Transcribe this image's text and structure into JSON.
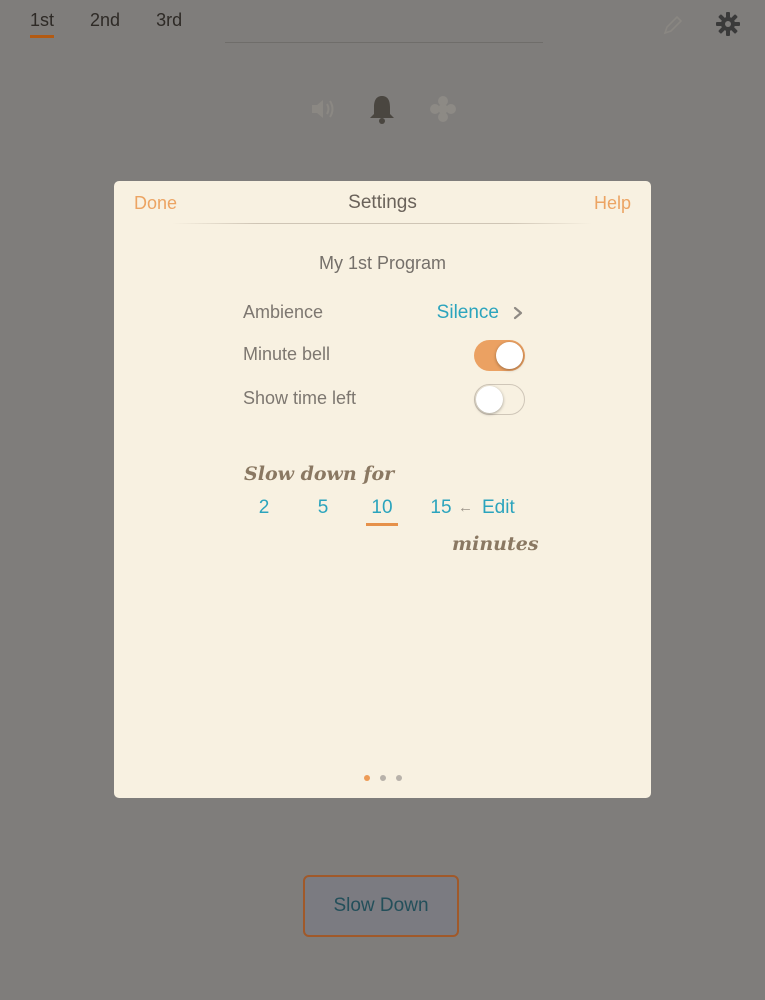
{
  "topTabs": [
    {
      "label": "1st",
      "active": true
    },
    {
      "label": "2nd",
      "active": false
    },
    {
      "label": "3rd",
      "active": false
    }
  ],
  "icons": {
    "pencil": "pencil-icon",
    "gear": "gear-icon",
    "speaker": "speaker-icon",
    "bell": "bell-icon",
    "flower": "flower-icon"
  },
  "mainButton": {
    "label": "Slow Down"
  },
  "modal": {
    "doneLabel": "Done",
    "title": "Settings",
    "helpLabel": "Help",
    "programTitle": "My 1st Program",
    "ambience": {
      "label": "Ambience",
      "value": "Silence"
    },
    "minuteBell": {
      "label": "Minute bell",
      "on": true
    },
    "showTimeLeft": {
      "label": "Show time left",
      "on": false
    },
    "slowDownFor": "Slow down for",
    "minuteOptions": [
      "2",
      "5",
      "10",
      "15"
    ],
    "selectedMinutes": "10",
    "arrow": "←",
    "editLabel": "Edit",
    "minutesLabel": "minutes",
    "pageDots": {
      "count": 3,
      "active": 0
    }
  },
  "colors": {
    "accentOrange": "#eca463",
    "linkBlue": "#2ba4bd",
    "overlayGray": "#7f7d7b",
    "modalBg": "#f8f1e1"
  }
}
